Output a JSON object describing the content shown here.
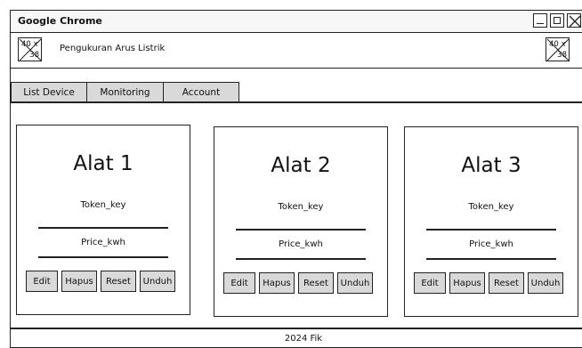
{
  "window": {
    "title": "Google Chrome"
  },
  "header": {
    "app_name": "Pengukuran Arus Listrik",
    "logo_text_top": "40 x",
    "logo_text_bottom": "38"
  },
  "nav": {
    "items": [
      "List Device",
      "Monitoring",
      "Account"
    ]
  },
  "devices": [
    {
      "name": "Alat 1",
      "field1": "Token_key",
      "field2": "Price_kwh",
      "buttons": [
        "Edit",
        "Hapus",
        "Reset",
        "Unduh"
      ]
    },
    {
      "name": "Alat 2",
      "field1": "Token_key",
      "field2": "Price_kwh",
      "buttons": [
        "Edit",
        "Hapus",
        "Reset",
        "Unduh"
      ]
    },
    {
      "name": "Alat 3",
      "field1": "Token_key",
      "field2": "Price_kwh",
      "buttons": [
        "Edit",
        "Hapus",
        "Reset",
        "Unduh"
      ]
    }
  ],
  "footer": {
    "text": "2024 Fik"
  }
}
